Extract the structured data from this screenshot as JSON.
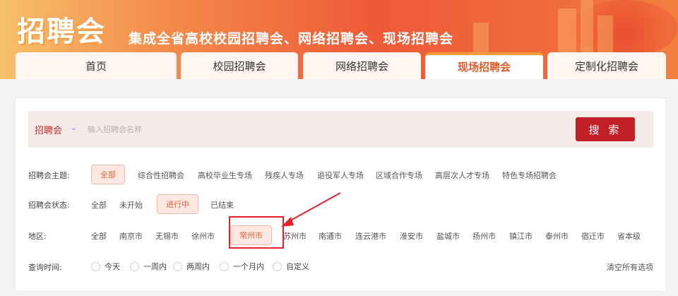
{
  "header": {
    "logo": "招聘会",
    "slogan": "集成全省高校校园招聘会、网络招聘会、现场招聘会",
    "tabs": [
      {
        "label": "首页",
        "active": false
      },
      {
        "label": "校园招聘会",
        "active": false
      },
      {
        "label": "网络招聘会",
        "active": false
      },
      {
        "label": "现场招聘会",
        "active": true
      },
      {
        "label": "定制化招聘会",
        "active": false
      }
    ]
  },
  "search": {
    "select_label": "招聘会",
    "placeholder": "输入招聘会名称",
    "button_label": "搜 索"
  },
  "filters": {
    "theme": {
      "label": "招聘会主题:",
      "options": [
        "全部",
        "综合性招聘会",
        "高校毕业生专场",
        "残疾人专场",
        "退役军人专场",
        "区域合作专场",
        "高层次人才专场",
        "特色专场招聘会"
      ],
      "selected": "全部"
    },
    "status": {
      "label": "招聘会状态:",
      "options": [
        "全部",
        "未开始",
        "进行中",
        "已结束"
      ],
      "selected": "进行中"
    },
    "region": {
      "label": "地区:",
      "options": [
        "全部",
        "南京市",
        "无锡市",
        "徐州市",
        "常州市",
        "苏州市",
        "南通市",
        "连云港市",
        "淮安市",
        "盐城市",
        "扬州市",
        "镇江市",
        "泰州市",
        "宿迁市",
        "省本级"
      ],
      "selected": "常州市"
    },
    "time": {
      "label": "查询时间:",
      "options": [
        "今天",
        "一周内",
        "两周内",
        "一个月内",
        "自定义"
      ],
      "clear_label": "清空所有选项"
    }
  },
  "colors": {
    "accent": "#e05a2a",
    "search_button": "#c21f27",
    "highlight_box": "#e8202a"
  }
}
